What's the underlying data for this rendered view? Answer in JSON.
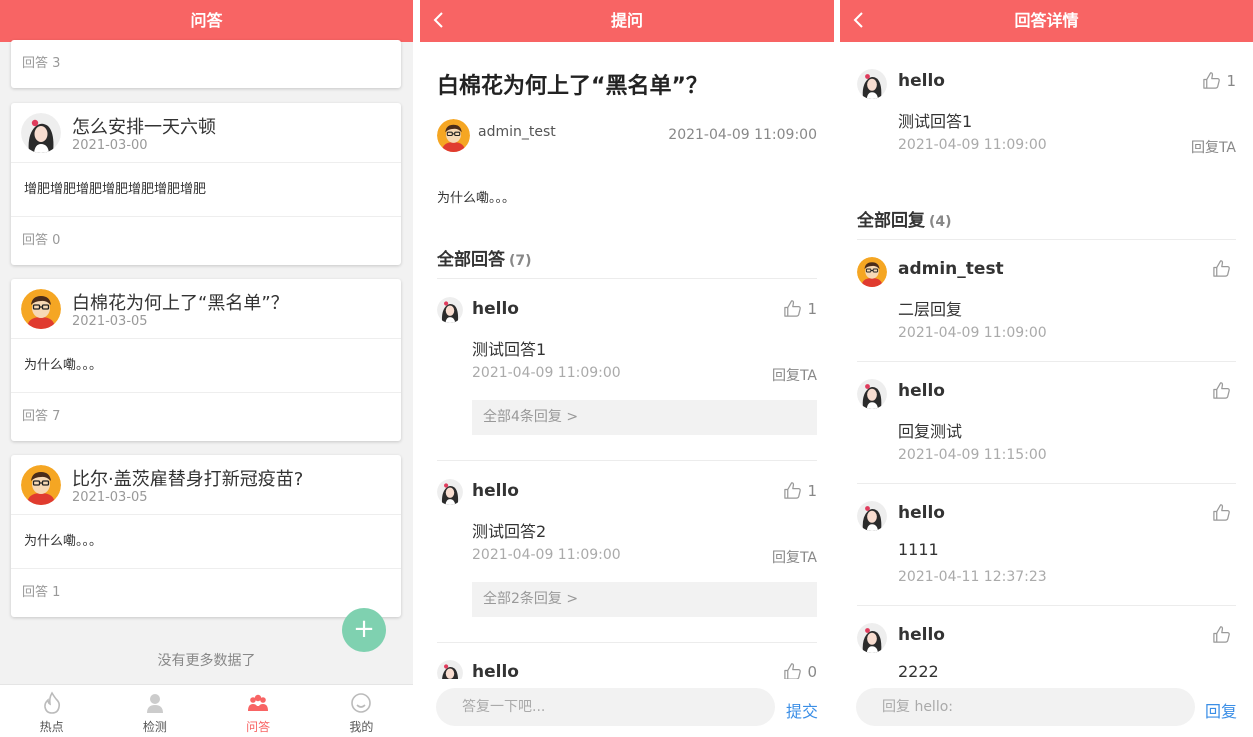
{
  "colors": {
    "brand": "#f86464",
    "fab": "#7fd1b0",
    "link": "#3a8ee6",
    "text": "#333333",
    "muted": "#999999"
  },
  "list_screen": {
    "header_title": "问答",
    "partial_card_footer": "回答 3",
    "cards": [
      {
        "title": "怎么安排一天六顿",
        "date": "2021-03-00",
        "body": "增肥增肥增肥增肥增肥增肥增肥",
        "footer": "回答 0",
        "avatar": "girl-avatar"
      },
      {
        "title": "白棉花为何上了“黑名单”？",
        "date": "2021-03-05",
        "body": "为什么嘞。。。",
        "footer": "回答 7",
        "avatar": "boy-avatar"
      },
      {
        "title": "比尔·盖茨雇替身打新冠疫苗?",
        "date": "2021-03-05",
        "body": "为什么嘞。。。",
        "footer": "回答 1",
        "avatar": "boy-avatar"
      }
    ],
    "no_more": "没有更多数据了",
    "fab_label": "+",
    "tabs": [
      {
        "label": "热点",
        "icon": "flame-icon"
      },
      {
        "label": "检测",
        "icon": "person-icon"
      },
      {
        "label": "问答",
        "icon": "group-icon",
        "active": true
      },
      {
        "label": "我的",
        "icon": "smile-icon"
      }
    ]
  },
  "question_screen": {
    "header_title": "提问",
    "title": "白棉花为何上了“黑名单”？",
    "author": "admin_test",
    "time": "2021-04-09 11:09:00",
    "body": "为什么嘞。。。",
    "section_title": "全部回答",
    "section_count": "(7)",
    "answers": [
      {
        "user": "hello",
        "likes": "1",
        "content": "测试回答1",
        "time": "2021-04-09 11:09:00",
        "reply": "回复TA",
        "more": "全部4条回复 >"
      },
      {
        "user": "hello",
        "likes": "1",
        "content": "测试回答2",
        "time": "2021-04-09 11:09:00",
        "reply": "回复TA",
        "more": "全部2条回复 >"
      },
      {
        "user": "hello",
        "likes": "0"
      }
    ],
    "input_placeholder": "答复一下吧...",
    "submit_label": "提交"
  },
  "detail_screen": {
    "header_title": "回答详情",
    "answer": {
      "user": "hello",
      "likes": "1",
      "content": "测试回答1",
      "time": "2021-04-09 11:09:00",
      "reply": "回复TA"
    },
    "section_title": "全部回复",
    "section_count": "(4)",
    "replies": [
      {
        "user": "admin_test",
        "content": "二层回复",
        "time": "2021-04-09 11:09:00"
      },
      {
        "user": "hello",
        "content": "回复测试",
        "time": "2021-04-09 11:15:00"
      },
      {
        "user": "hello",
        "content": "1111",
        "time": "2021-04-11 12:37:23"
      },
      {
        "user": "hello",
        "content": "2222"
      }
    ],
    "input_placeholder": "回复 hello:",
    "submit_label": "回复"
  }
}
